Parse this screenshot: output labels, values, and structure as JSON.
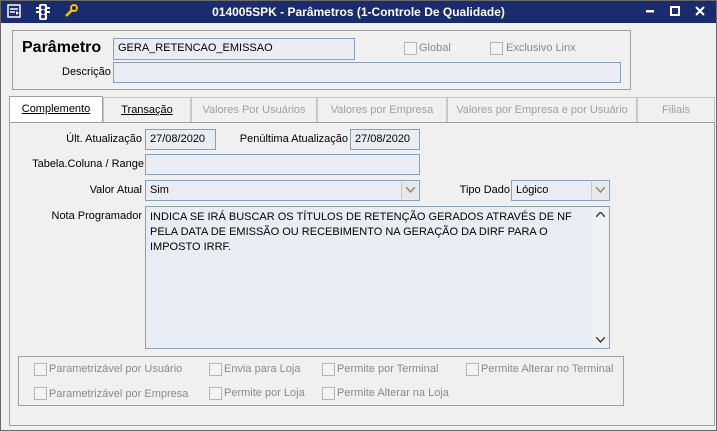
{
  "window": {
    "title": "014005SPK - Parâmetros (1-Controle De Qualidade)"
  },
  "header": {
    "parametro_label": "Parâmetro",
    "parametro_value": "GERA_RETENCAO_EMISSAO",
    "global_label": "Global",
    "exclusivo_label": "Exclusivo Linx",
    "descricao_label": "Descrição",
    "descricao_value": ""
  },
  "tabs": [
    {
      "label": "Complemento",
      "active": true
    },
    {
      "label": "Transação",
      "active": false
    },
    {
      "label": "Valores Por Usuários",
      "active": false
    },
    {
      "label": "Valores por Empresa",
      "active": false
    },
    {
      "label": "Valores por Empresa e por Usuário",
      "active": false
    },
    {
      "label": "Filiais",
      "active": false
    }
  ],
  "form": {
    "ult_atualizacao_label": "Últ. Atualização",
    "ult_atualizacao_value": "27/08/2020",
    "penultima_label": "Penúltima Atualização",
    "penultima_value": "27/08/2020",
    "tabela_label": "Tabela.Coluna / Range",
    "tabela_value": "",
    "valor_atual_label": "Valor Atual",
    "valor_atual_value": "Sim",
    "tipo_dado_label": "Tipo Dado",
    "tipo_dado_value": "Lógico",
    "nota_label": "Nota Programador",
    "nota_value": "INDICA SE IRÁ BUSCAR OS TÍTULOS DE RETENÇÃO GERADOS ATRAVÉS DE NF PELA DATA DE EMISSÃO OU RECEBIMENTO NA GERAÇÃO DA DIRF PARA O IMPOSTO IRRF."
  },
  "options": {
    "parametrizavel_usuario": "Parametrizável por Usuário",
    "envia_loja": "Envia para Loja",
    "permite_terminal": "Permite por Terminal",
    "permite_alterar_terminal": "Permite Alterar no Terminal",
    "parametrizavel_empresa": "Parametrizável por Empresa",
    "permite_loja": "Permite por Loja",
    "permite_alterar_loja": "Permite Alterar na Loja"
  },
  "icons": {
    "menu": "window-menu-icon",
    "traffic": "traffic-light-icon",
    "tools": "wrench-icon"
  },
  "colors": {
    "titlebar": "#1a2b6e",
    "field_bg": "#e9edf3"
  }
}
